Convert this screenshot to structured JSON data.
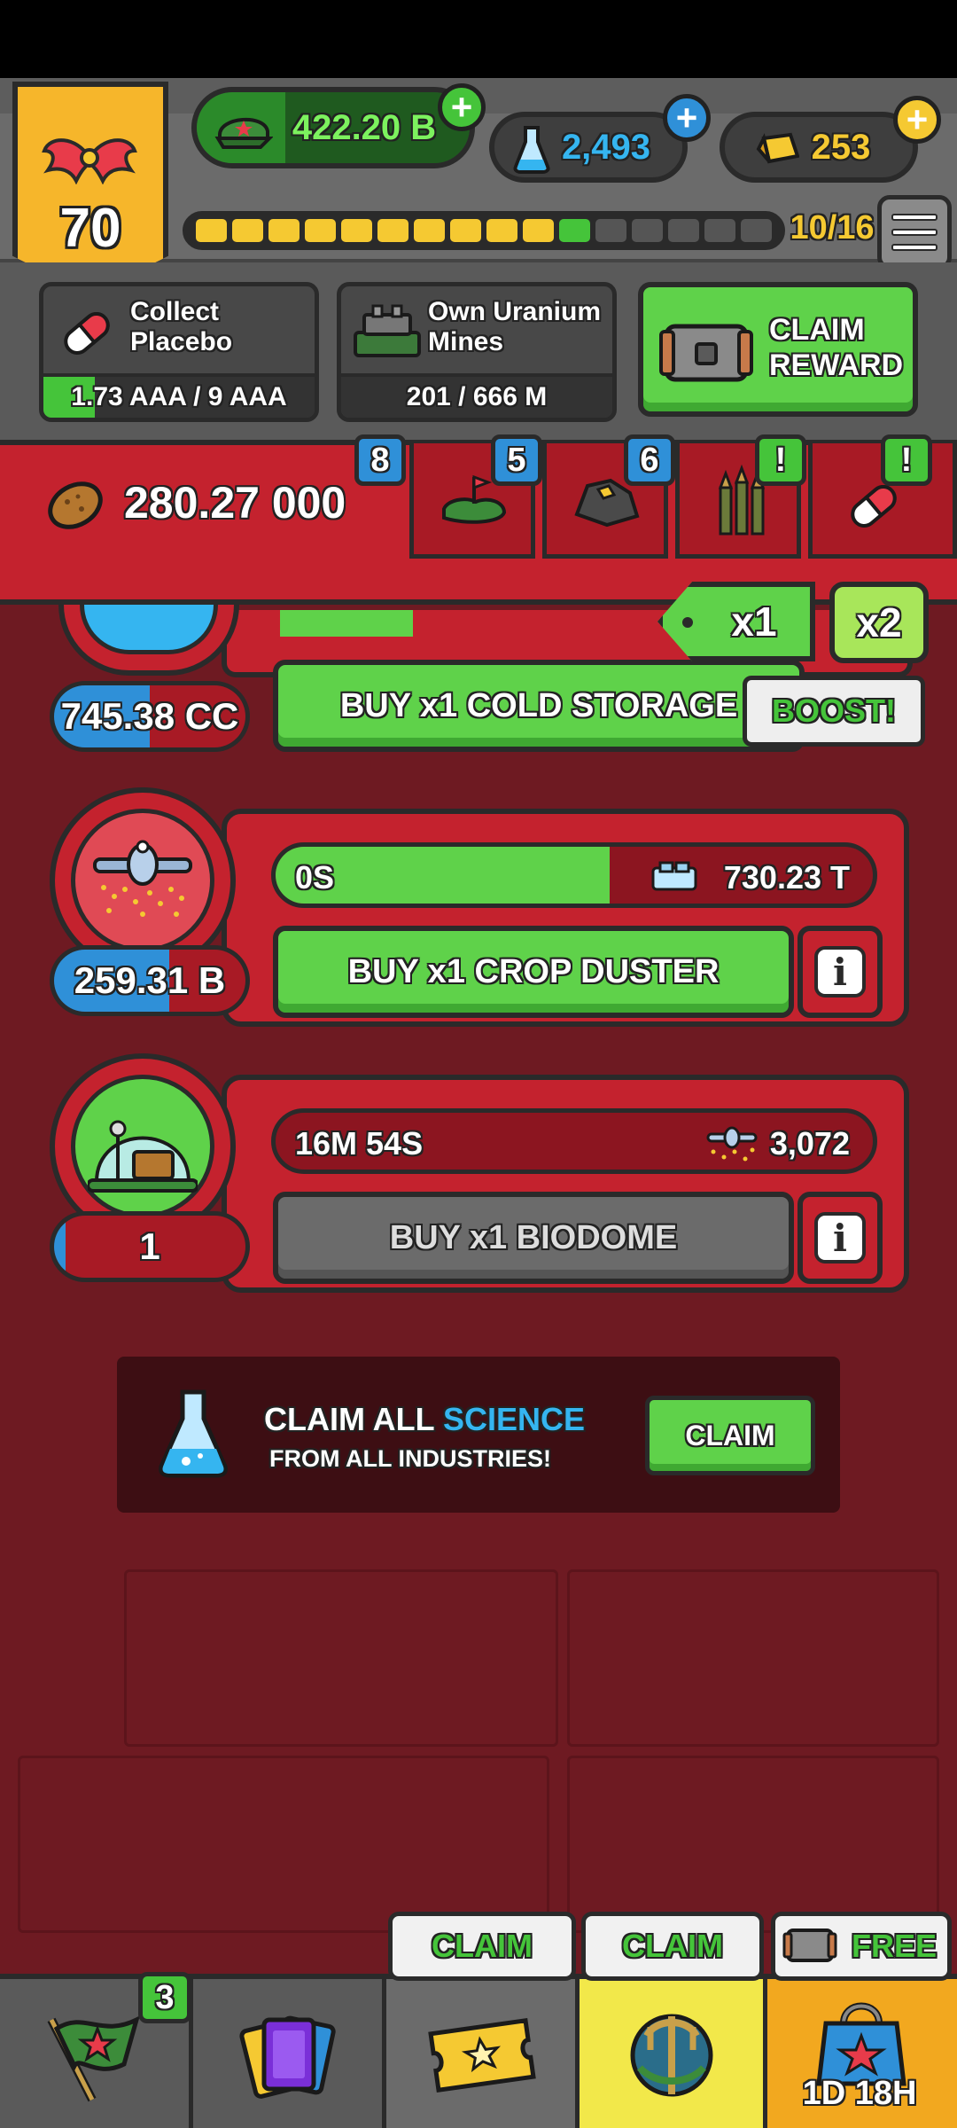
{
  "header": {
    "level": "70",
    "cash": "422.20 B",
    "science": "2,493",
    "gold": "253",
    "xp_progress": "10/16",
    "xp_segments_total": 16,
    "xp_segments_filled": 10
  },
  "quests": [
    {
      "title": "Collect Placebo",
      "progress": "1.73 AAA / 9 AAA",
      "fill": 0.19
    },
    {
      "title": "Own Uranium Mines",
      "progress": "201 / 666 M",
      "fill": 0.0
    }
  ],
  "claim_reward": {
    "label": "CLAIM REWARD"
  },
  "tabs": {
    "resource_count": "280.27 000",
    "items": [
      {
        "name": "farm",
        "badge": "8",
        "badge_color": "blue"
      },
      {
        "name": "mine",
        "badge": "5",
        "badge_color": "blue"
      },
      {
        "name": "ammo",
        "badge": "6",
        "badge_color": "blue"
      },
      {
        "name": "pill",
        "badge": "!",
        "badge_color": "green"
      },
      {
        "name": "extra",
        "badge": "!",
        "badge_color": "green"
      }
    ]
  },
  "multiplier": {
    "current": "x1",
    "boost": "x2"
  },
  "industries": [
    {
      "name": "cold-storage",
      "count": "745.38 CC",
      "button": "BUY x1 COLD STORAGE",
      "boost_label": "BOOST!"
    },
    {
      "name": "crop-duster",
      "count": "259.31 B",
      "timer": "0S",
      "rate": "730.23 T",
      "button": "BUY x1 CROP DUSTER",
      "progress": 0.56
    },
    {
      "name": "biodome",
      "count": "1",
      "timer": "16M  54S",
      "rate": "3,072",
      "button": "BUY x1 BIODOME",
      "progress": 0.0
    }
  ],
  "science_panel": {
    "line1_prefix": "CLAIM ALL",
    "line1_highlight": "SCIENCE",
    "line2": "FROM ALL INDUSTRIES!",
    "button": "CLAIM"
  },
  "bottom_nav": {
    "missions_badge": "3",
    "claim_1": "CLAIM",
    "claim_2": "CLAIM",
    "free_label": "FREE",
    "shop_timer": "1D 18H"
  },
  "colors": {
    "accent_green": "#5fd24a",
    "accent_red": "#c4222e",
    "science_blue": "#35b5f0",
    "gold": "#f5c932"
  }
}
